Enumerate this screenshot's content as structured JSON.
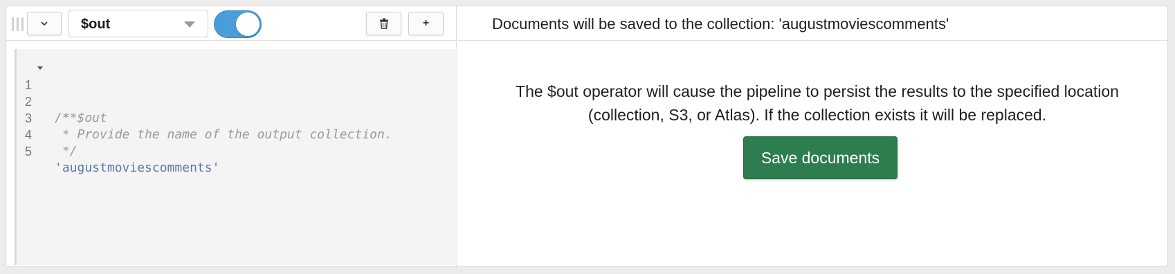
{
  "stage": {
    "selected_operator": "$out",
    "enabled": true,
    "add_label": "+",
    "icons": {
      "drag": "drag-handle-icon",
      "collapse": "chevron-down-icon",
      "delete": "trash-icon"
    }
  },
  "editor": {
    "lines": [
      {
        "num": "1",
        "text": "/**",
        "kind": "comment"
      },
      {
        "num": "2",
        "text": " * $out",
        "kind": "comment"
      },
      {
        "num": "3",
        "text": " * Provide the name of the output collection.",
        "kind": "comment"
      },
      {
        "num": "4",
        "text": " */",
        "kind": "comment"
      },
      {
        "num": "5",
        "text": "'augustmoviescomments'",
        "kind": "string"
      }
    ]
  },
  "preview": {
    "header": "Documents will be saved to the collection: 'augustmoviescomments'",
    "message": "The $out operator will cause the pipeline to persist the results to the specified location (collection, S3, or Atlas). If the collection exists it will be replaced.",
    "save_button": "Save documents"
  },
  "colors": {
    "toggle_on": "#4a9ddb",
    "save_button": "#2e7d4f",
    "comment": "#9a9a9a",
    "string": "#5a78a8"
  }
}
